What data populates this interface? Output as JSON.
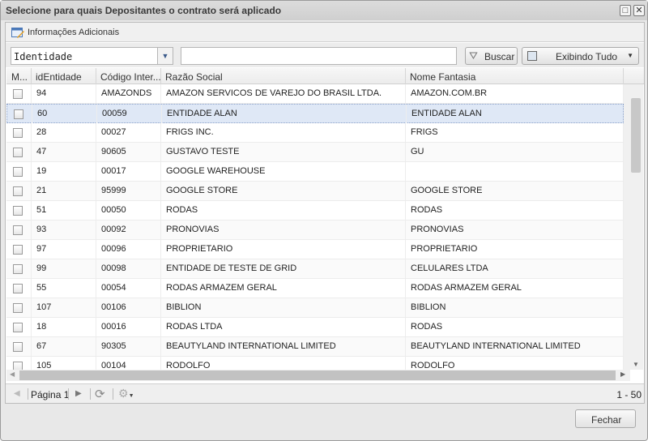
{
  "window": {
    "title": "Selecione para quais Depositantes o contrato será aplicado",
    "maximize_icon": "□",
    "close_icon": "✕"
  },
  "toolbar": {
    "info_label": "Informações Adicionais"
  },
  "filter": {
    "field_value": "Identidade",
    "search_value": "",
    "search_button": "Buscar",
    "view_button": "Exibindo Tudo"
  },
  "columns": [
    "M...",
    "idEntidade",
    "Código Inter...",
    "Razão Social",
    "Nome Fantasia"
  ],
  "rows": [
    {
      "id": "94",
      "codigo": "AMAZONDS",
      "razao": "AMAZON SERVICOS DE VAREJO DO BRASIL LTDA.",
      "nome": "AMAZON.COM.BR"
    },
    {
      "id": "60",
      "codigo": "00059",
      "razao": "ENTIDADE ALAN",
      "nome": "ENTIDADE ALAN"
    },
    {
      "id": "28",
      "codigo": "00027",
      "razao": "FRIGS INC.",
      "nome": "FRIGS"
    },
    {
      "id": "47",
      "codigo": "90605",
      "razao": "GUSTAVO TESTE",
      "nome": "GU"
    },
    {
      "id": "19",
      "codigo": "00017",
      "razao": "GOOGLE WAREHOUSE",
      "nome": ""
    },
    {
      "id": "21",
      "codigo": "95999",
      "razao": "GOOGLE STORE",
      "nome": "GOOGLE STORE"
    },
    {
      "id": "51",
      "codigo": "00050",
      "razao": "RODAS",
      "nome": "RODAS"
    },
    {
      "id": "93",
      "codigo": "00092",
      "razao": "PRONOVIAS",
      "nome": "PRONOVIAS"
    },
    {
      "id": "97",
      "codigo": "00096",
      "razao": "PROPRIETARIO",
      "nome": "PROPRIETARIO"
    },
    {
      "id": "99",
      "codigo": "00098",
      "razao": "ENTIDADE DE TESTE DE GRID",
      "nome": "CELULARES LTDA"
    },
    {
      "id": "55",
      "codigo": "00054",
      "razao": "RODAS ARMAZEM GERAL",
      "nome": "RODAS ARMAZEM GERAL"
    },
    {
      "id": "107",
      "codigo": "00106",
      "razao": "BIBLION",
      "nome": "BIBLION"
    },
    {
      "id": "18",
      "codigo": "00016",
      "razao": "RODAS LTDA",
      "nome": "RODAS"
    },
    {
      "id": "67",
      "codigo": "90305",
      "razao": "BEAUTYLAND INTERNATIONAL LIMITED",
      "nome": "BEAUTYLAND INTERNATIONAL LIMITED"
    },
    {
      "id": "105",
      "codigo": "00104",
      "razao": "RODOLFO",
      "nome": "RODOLFO"
    }
  ],
  "selected_row": 1,
  "pager": {
    "page_label": "Página 1",
    "range": "1 - 50"
  },
  "footer": {
    "close_button": "Fechar"
  }
}
